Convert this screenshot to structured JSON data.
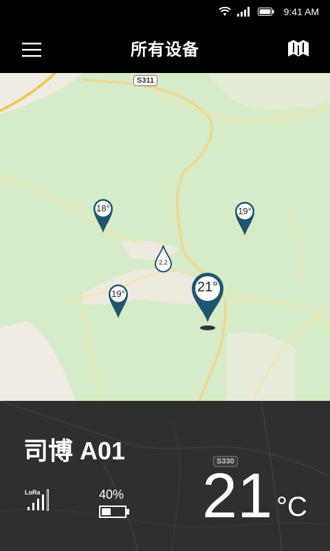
{
  "status_bar": {
    "time": "9:41 AM"
  },
  "app_bar": {
    "title": "所有设备"
  },
  "map": {
    "road_labels": [
      "S311",
      "S330"
    ],
    "markers": [
      {
        "label": "18°"
      },
      {
        "label": "19°"
      },
      {
        "label": "2.2"
      },
      {
        "label": "19°"
      },
      {
        "label": "21°"
      }
    ]
  },
  "device": {
    "name": "司博 A01",
    "signal_label": "LoRa",
    "battery": "40%",
    "temperature": "21",
    "unit": "°C"
  },
  "colors": {
    "marker": "#1e5670",
    "map_land": "#d6ebc7",
    "panel": "#2f302e"
  }
}
